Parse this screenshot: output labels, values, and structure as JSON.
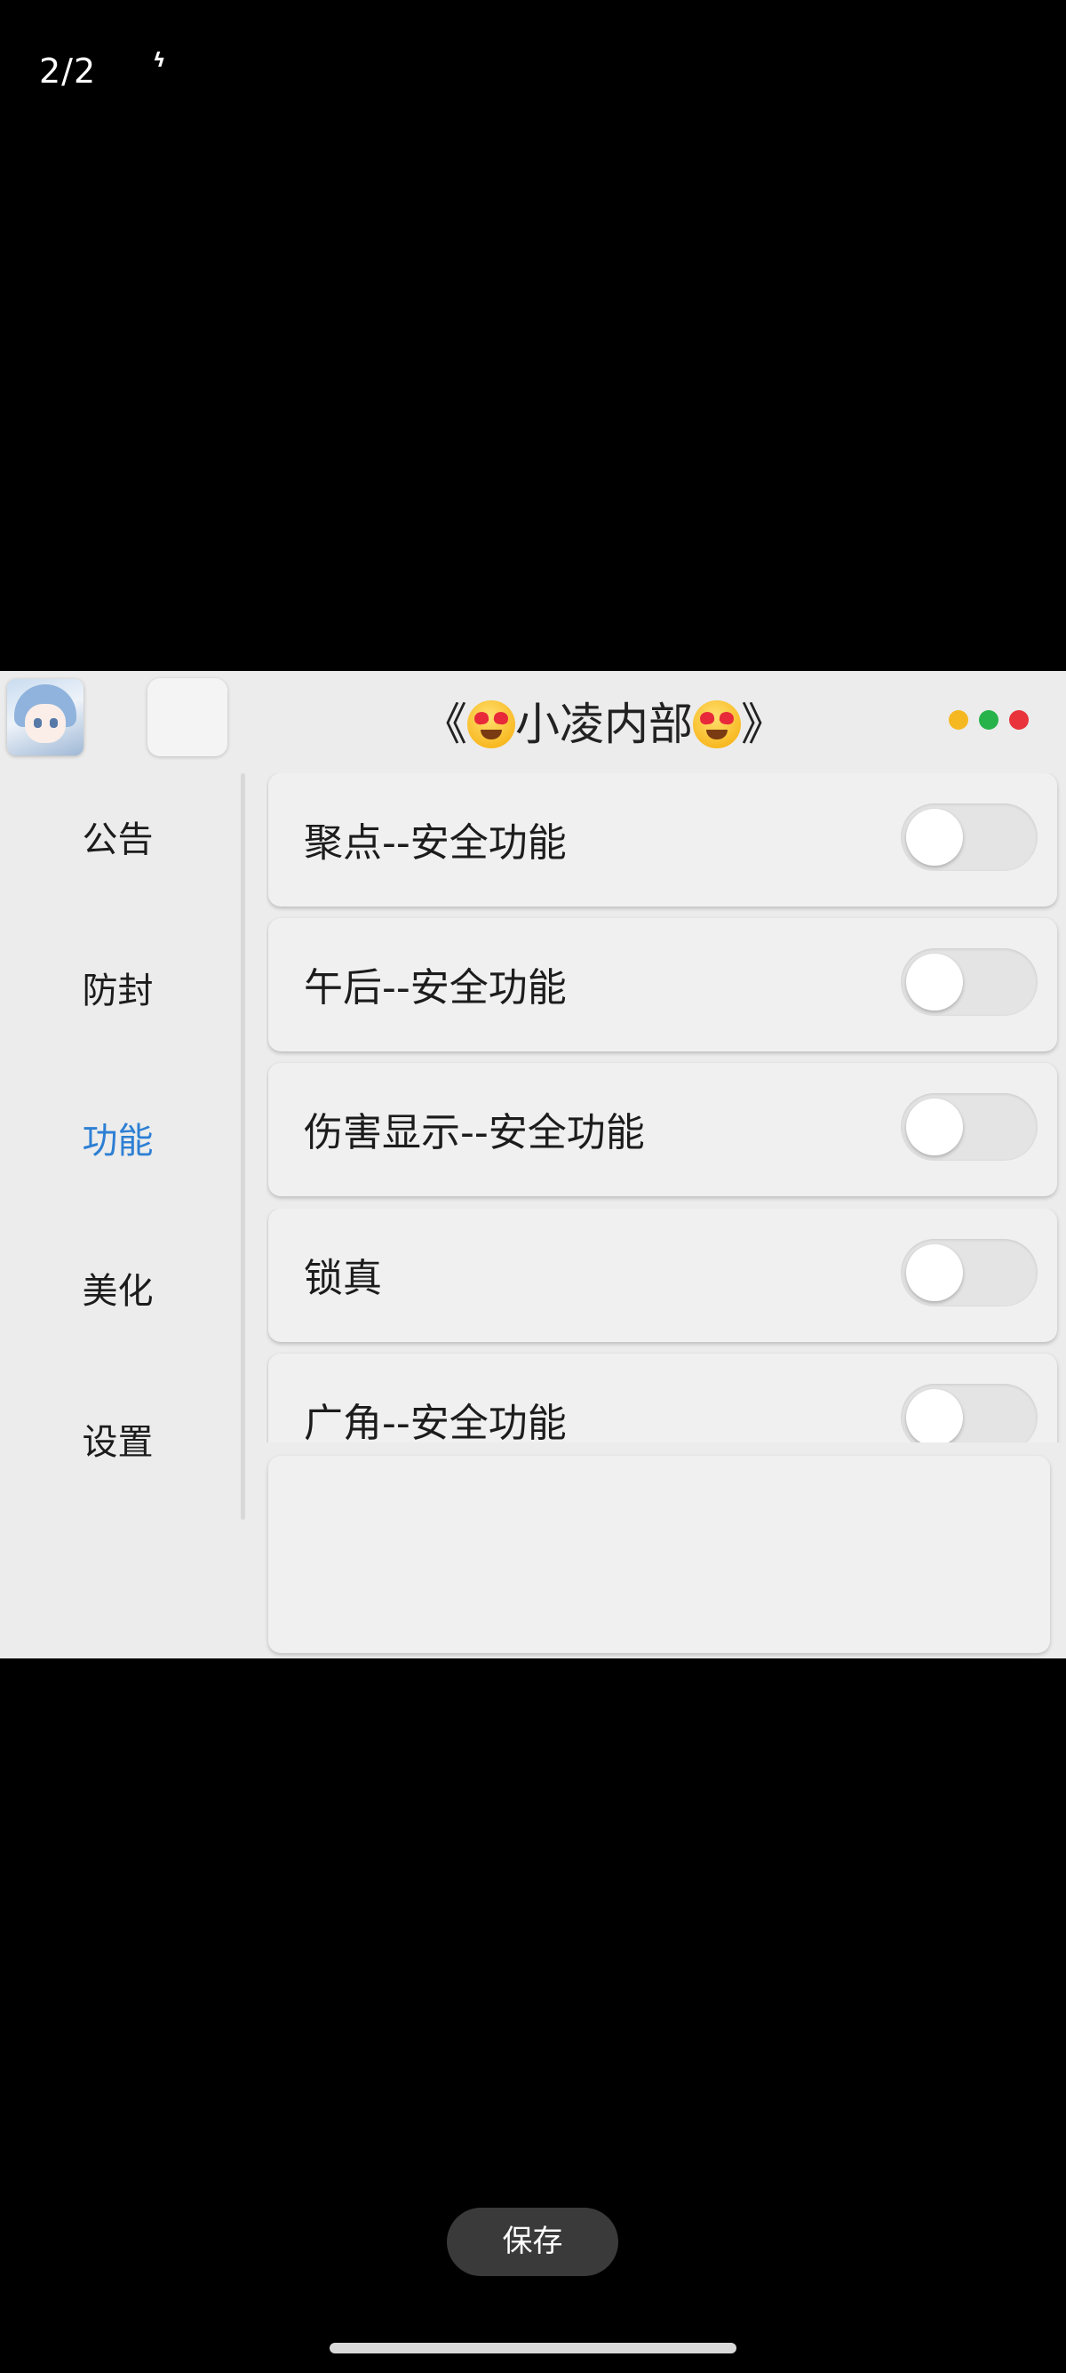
{
  "viewer": {
    "page_counter": "2/2",
    "status_icon": "ϟ",
    "save_label": "保存"
  },
  "app": {
    "title_prefix": "《",
    "title_text": "小凌内部",
    "title_suffix": "》",
    "title_emoji": "heart-eyes-emoji",
    "window_dots": [
      "#f5b820",
      "#27b34a",
      "#e8343a"
    ]
  },
  "sidebar": {
    "items": [
      {
        "label": "公告",
        "active": false
      },
      {
        "label": "防封",
        "active": false
      },
      {
        "label": "功能",
        "active": true
      },
      {
        "label": "美化",
        "active": false
      },
      {
        "label": "设置",
        "active": false
      }
    ],
    "active_color": "#2d7fd4"
  },
  "features": [
    {
      "label": "聚点--安全功能",
      "enabled": false
    },
    {
      "label": "午后--安全功能",
      "enabled": false
    },
    {
      "label": "伤害显示--安全功能",
      "enabled": false
    },
    {
      "label": "锁真",
      "enabled": false
    },
    {
      "label": "广角--安全功能",
      "enabled": false
    }
  ]
}
